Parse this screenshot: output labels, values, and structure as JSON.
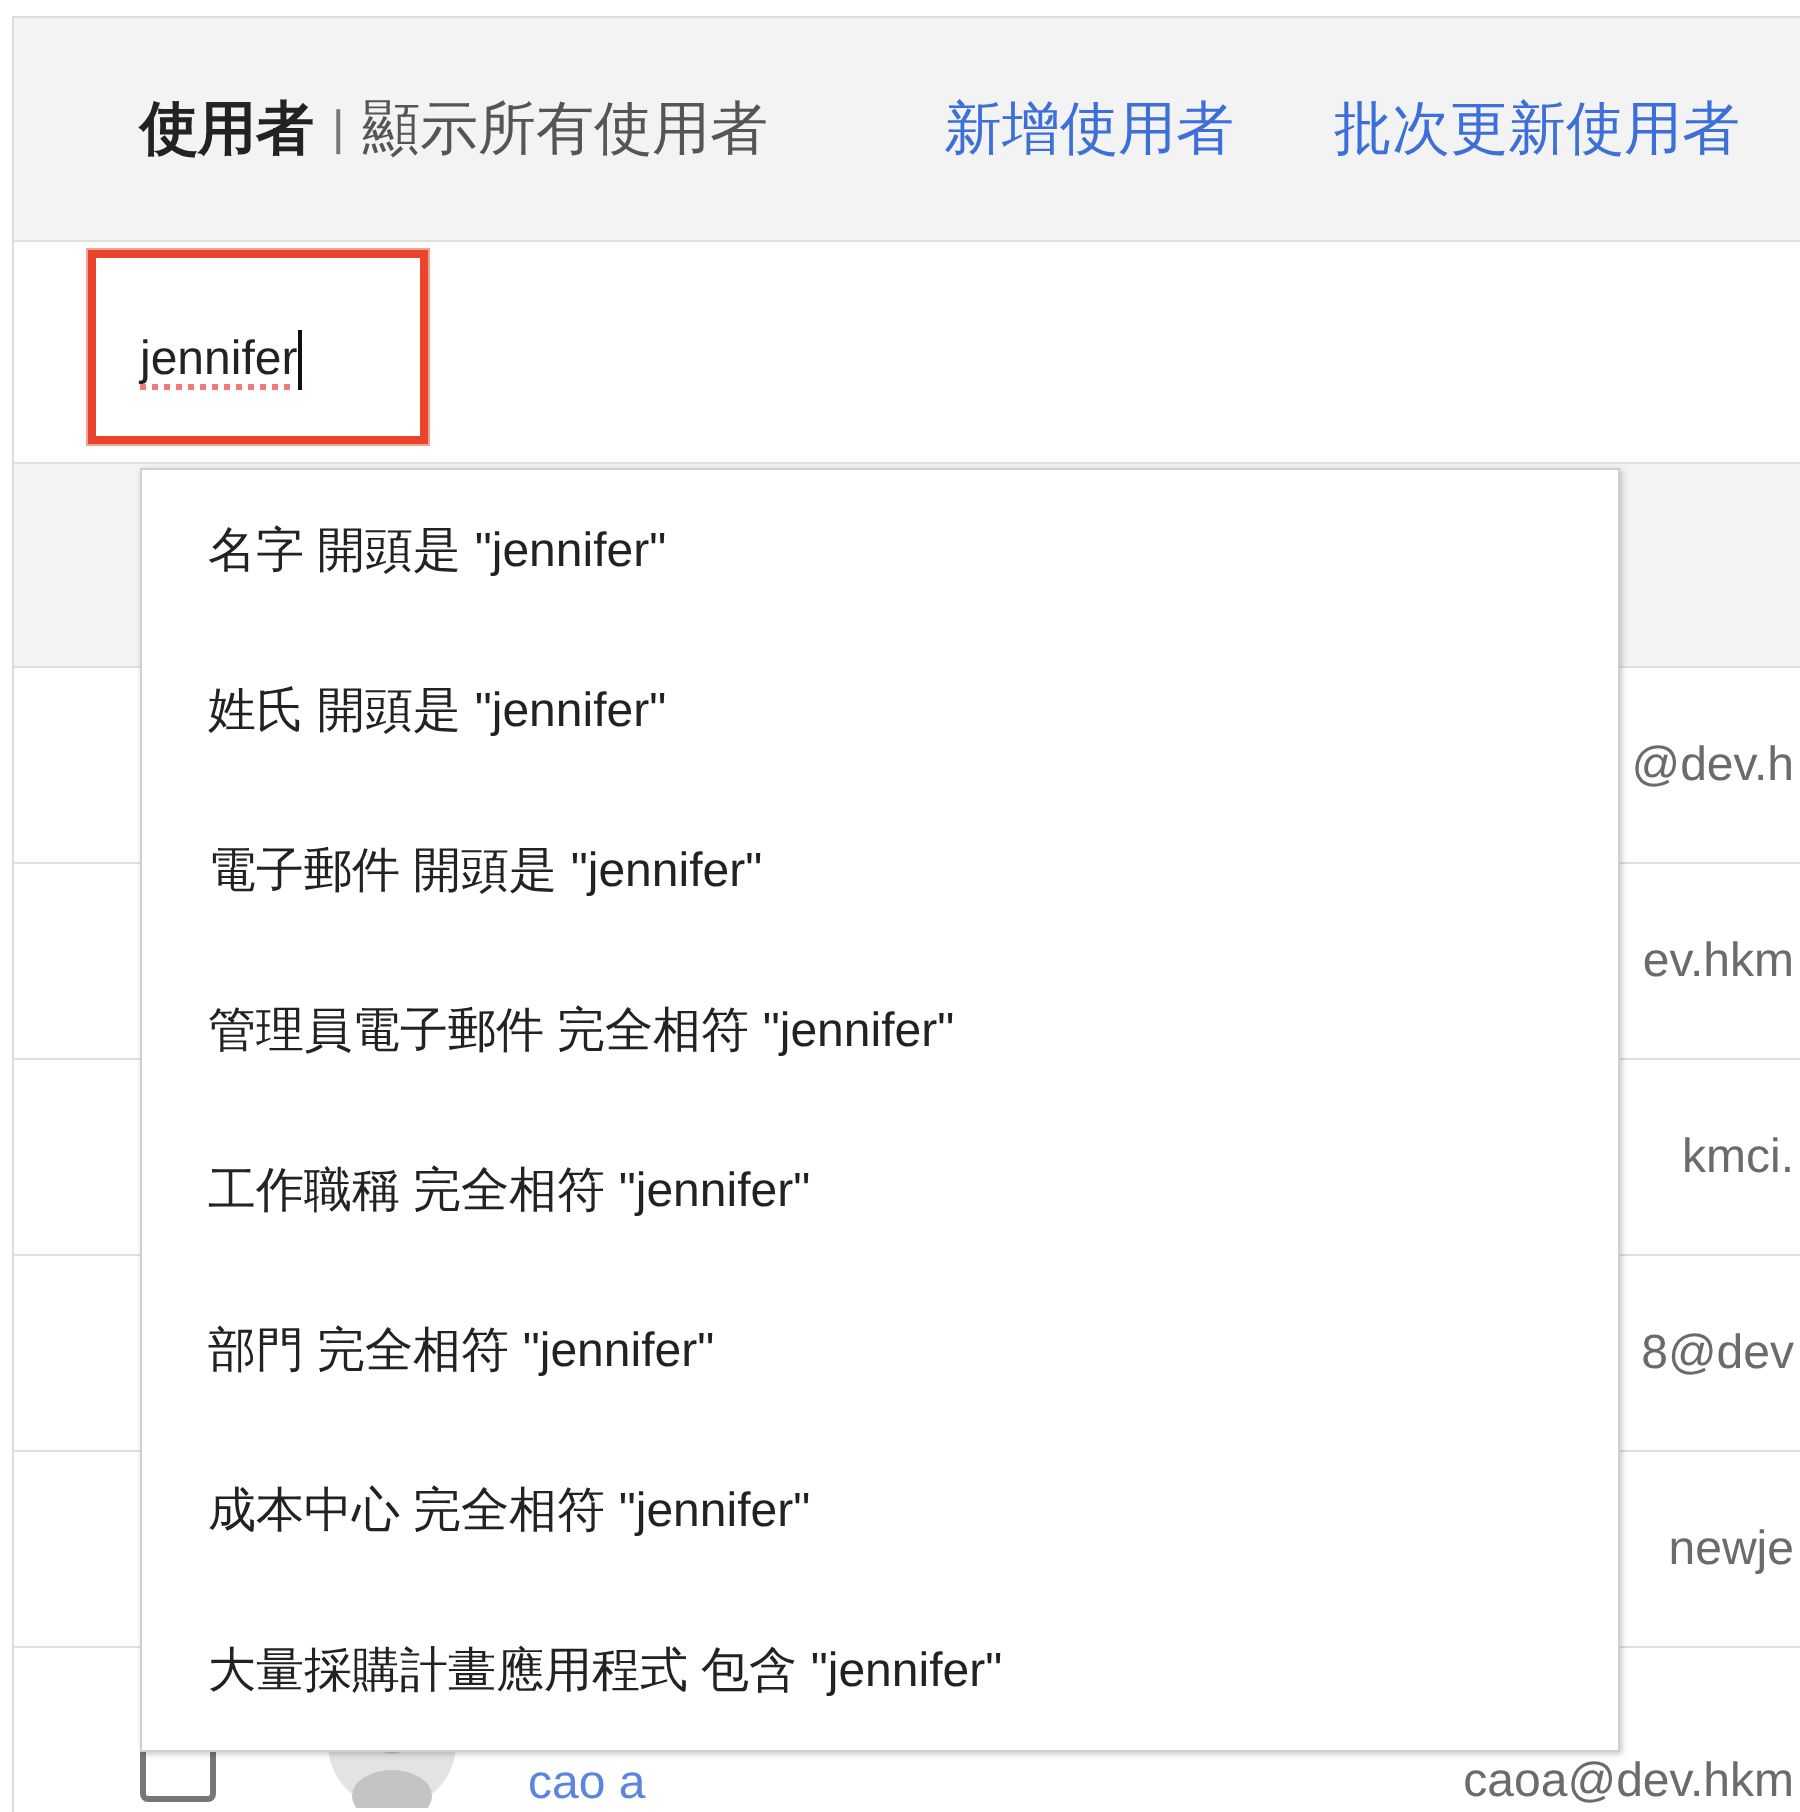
{
  "header": {
    "title": "使用者",
    "separator": "|",
    "subtitle": "顯示所有使用者",
    "links": [
      "新增使用者",
      "批次更新使用者"
    ]
  },
  "search": {
    "value": "jennifer",
    "misspelled": true,
    "focused": true
  },
  "suggestions": [
    {
      "label": "名字 開頭是 \"jennifer\"",
      "selected": false
    },
    {
      "label": "姓氏 開頭是 \"jennifer\"",
      "selected": false
    },
    {
      "label": "電子郵件 開頭是 \"jennifer\"",
      "selected": false
    },
    {
      "label": "管理員電子郵件 完全相符 \"jennifer\"",
      "selected": false
    },
    {
      "label": "工作職稱 完全相符 \"jennifer\"",
      "selected": false
    },
    {
      "label": "部門 完全相符 \"jennifer\"",
      "selected": false
    },
    {
      "label": "成本中心 完全相符 \"jennifer\"",
      "selected": false
    },
    {
      "label": "大量採購計畫應用程式 包含 \"jennifer\"",
      "selected": false
    }
  ],
  "table": {
    "rows": [
      {
        "email": "@dev.h"
      },
      {
        "email": "ev.hkm"
      },
      {
        "email": "kmci."
      },
      {
        "email": "8@dev"
      },
      {
        "email": "newje"
      },
      {
        "checked": false,
        "name": "cao a",
        "email": "caoa@dev.hkm"
      }
    ]
  }
}
